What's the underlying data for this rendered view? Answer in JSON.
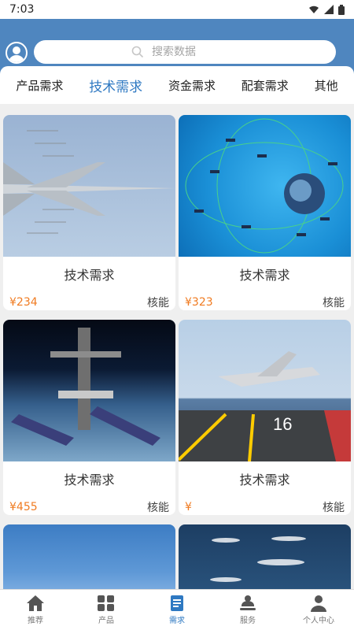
{
  "status_bar": {
    "time": "7:03"
  },
  "search": {
    "placeholder": "搜索数据"
  },
  "tabs": [
    {
      "label": "产品需求",
      "active": false
    },
    {
      "label": "技术需求",
      "active": true
    },
    {
      "label": "资金需求",
      "active": false
    },
    {
      "label": "配套需求",
      "active": false
    },
    {
      "label": "其他",
      "active": false
    }
  ],
  "cards": [
    {
      "title": "技术需求",
      "price": "¥234",
      "tag": "核能",
      "image": "fighter-jet"
    },
    {
      "title": "技术需求",
      "price": "¥323",
      "tag": "核能",
      "image": "satellite-network"
    },
    {
      "title": "技术需求",
      "price": "¥455",
      "tag": "核能",
      "image": "space-station"
    },
    {
      "title": "技术需求",
      "price": "¥",
      "tag": "核能",
      "image": "carrier-jet"
    },
    {
      "title": "",
      "price": "",
      "tag": "",
      "image": "sky"
    },
    {
      "title": "",
      "price": "",
      "tag": "",
      "image": "sea-fleet"
    }
  ],
  "bottom_nav": [
    {
      "label": "推荐",
      "icon": "home-icon",
      "active": false
    },
    {
      "label": "产品",
      "icon": "grid-icon",
      "active": false
    },
    {
      "label": "需求",
      "icon": "document-icon",
      "active": true
    },
    {
      "label": "服务",
      "icon": "service-icon",
      "active": false
    },
    {
      "label": "个人中心",
      "icon": "person-icon",
      "active": false
    }
  ],
  "colors": {
    "header": "#4f86bf",
    "accent": "#2f79c2",
    "price": "#f07b21"
  }
}
